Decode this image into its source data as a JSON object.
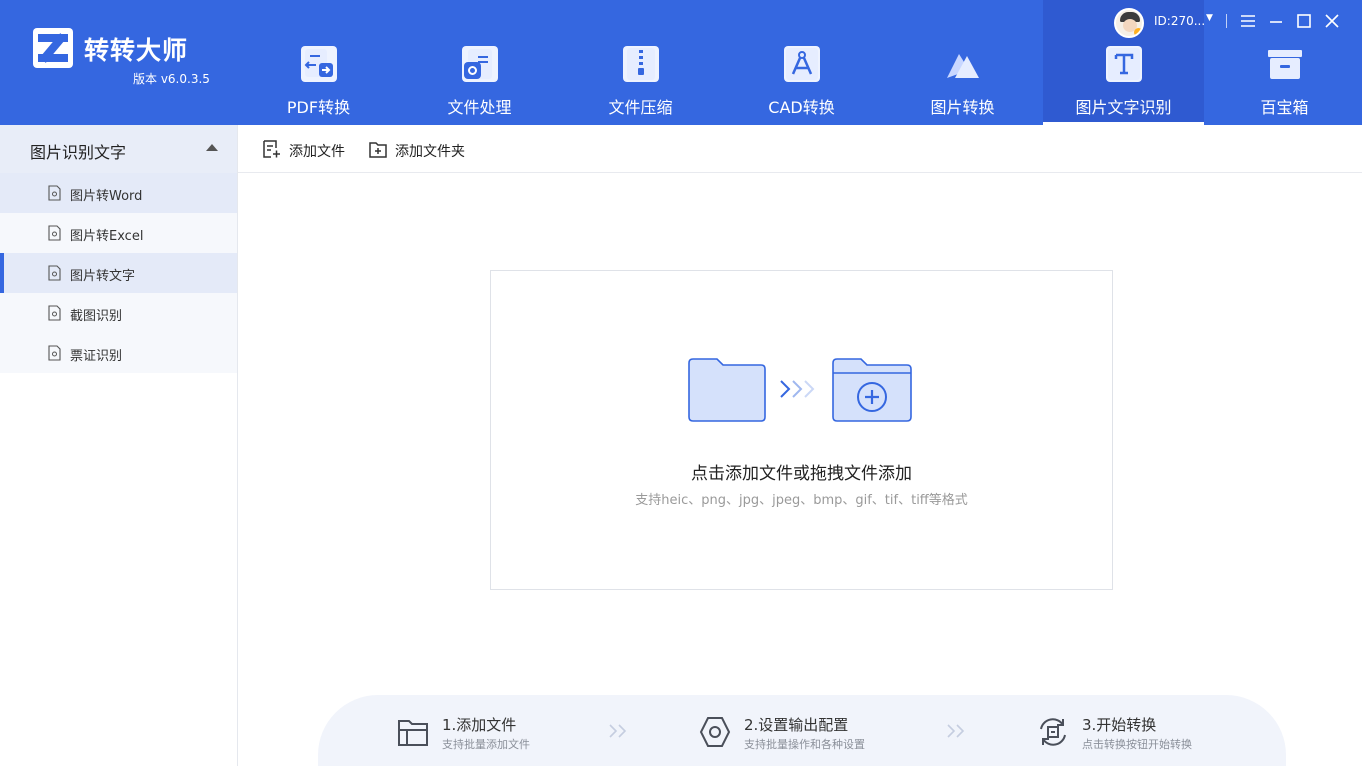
{
  "app": {
    "name": "转转大师",
    "version": "版本 v6.0.3.5"
  },
  "user": {
    "id": "ID:270..."
  },
  "nav": {
    "items": [
      {
        "label": "PDF转换"
      },
      {
        "label": "文件处理"
      },
      {
        "label": "文件压缩"
      },
      {
        "label": "CAD转换"
      },
      {
        "label": "图片转换"
      },
      {
        "label": "图片文字识别"
      },
      {
        "label": "百宝箱"
      }
    ],
    "active": "图片文字识别"
  },
  "sidebar": {
    "section_title": "图片识别文字",
    "items": [
      {
        "label": "图片转Word"
      },
      {
        "label": "图片转Excel"
      },
      {
        "label": "图片转文字"
      },
      {
        "label": "截图识别"
      },
      {
        "label": "票证识别"
      }
    ],
    "active": "图片转文字"
  },
  "toolbar": {
    "add_file": "添加文件",
    "add_folder": "添加文件夹"
  },
  "dropzone": {
    "title": "点击添加文件或拖拽文件添加",
    "formats": "支持heic、png、jpg、jpeg、bmp、gif、tif、tiff等格式"
  },
  "steps": [
    {
      "title": "1.添加文件",
      "desc": "支持批量添加文件"
    },
    {
      "title": "2.设置输出配置",
      "desc": "支持批量操作和各种设置"
    },
    {
      "title": "3.开始转换",
      "desc": "点击转换按钮开始转换"
    }
  ],
  "colors": {
    "brand": "#3567e0",
    "sidebar_active": "#e4eaf8",
    "steps_bg": "#f1f4fb"
  },
  "icons": {
    "window": [
      "menu-icon",
      "minimize-icon",
      "maximize-icon",
      "close-icon"
    ],
    "nav": [
      "pdf-convert-icon",
      "file-process-icon",
      "file-compress-icon",
      "cad-convert-icon",
      "image-convert-icon",
      "ocr-text-icon",
      "toolbox-icon"
    ]
  }
}
